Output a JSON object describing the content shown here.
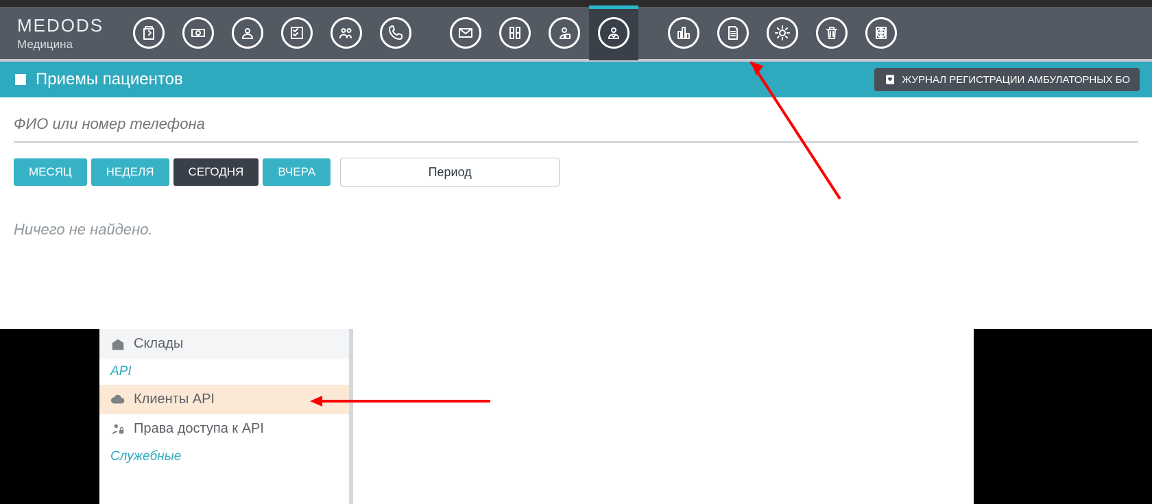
{
  "brand": {
    "line1": "MEDODS",
    "line2": "Медицина"
  },
  "nav": {
    "items": [
      {
        "name": "clipboard-icon"
      },
      {
        "name": "money-icon"
      },
      {
        "name": "person-icon"
      },
      {
        "name": "checklist-icon"
      },
      {
        "name": "people-phone-icon"
      },
      {
        "name": "phone-icon"
      },
      {
        "name": "mail-icon",
        "gap": true
      },
      {
        "name": "pills-icon"
      },
      {
        "name": "desk-icon"
      },
      {
        "name": "doctor-icon",
        "active": true
      },
      {
        "name": "chart-icon",
        "gap": true
      },
      {
        "name": "document-icon"
      },
      {
        "name": "gear-icon"
      },
      {
        "name": "trash-icon"
      },
      {
        "name": "globe-book-icon"
      }
    ]
  },
  "pageHeader": {
    "title": "Приемы пациентов",
    "journalButton": "ЖУРНАЛ РЕГИСТРАЦИИ АМБУЛАТОРНЫХ БО"
  },
  "search": {
    "placeholder": "ФИО или номер телефона"
  },
  "filters": {
    "month": "МЕСЯЦ",
    "week": "НЕДЕЛЯ",
    "today": "СЕГОДНЯ",
    "yesterday": "ВЧЕРА",
    "period": "Период"
  },
  "emptyState": "Ничего не найдено.",
  "sidePanel": {
    "item1": "Склады",
    "header1": "API",
    "item2": "Клиенты API",
    "item3": "Права доступа к API",
    "header2": "Служебные"
  }
}
